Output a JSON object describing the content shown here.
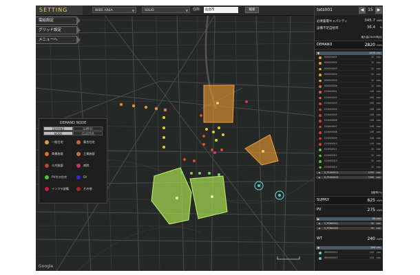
{
  "topbar": {
    "title": "SETTING",
    "area_select": "WIDE AREA",
    "mode_select": "SOLID",
    "location_label": "住所:",
    "location_value": "仙台市",
    "search_button": "検索"
  },
  "side_menu": [
    "需給設定",
    "グリッド設定",
    "メニューへ"
  ],
  "legend": {
    "title": "DEMAND NODE",
    "tabs_row1": [
      "DEMAND",
      "SUPPLY"
    ],
    "tabs_row2": [
      "NODE",
      "CLUSTER"
    ],
    "items": [
      {
        "label": "一般住宅",
        "color": "#e0a030"
      },
      {
        "label": "集合住宅",
        "color": "#d06040"
      },
      {
        "label": "商業施設",
        "color": "#e07030"
      },
      {
        "label": "工業施設",
        "color": "#c87050"
      },
      {
        "label": "公共施設",
        "color": "#c84040"
      },
      {
        "label": "病院",
        "color": "#c83070"
      },
      {
        "label": "PV付き住宅",
        "color": "#55c040"
      },
      {
        "label": "EV",
        "color": "#2a2ad0"
      },
      {
        "label": "インフラ設備",
        "color": "#c02040"
      },
      {
        "label": "その他",
        "color": "#b02020"
      }
    ]
  },
  "map": {
    "google_text": "Google",
    "node_colors": {
      "orange": "#e0913a",
      "yellow": "#e3d02c",
      "red": "#d0503a",
      "magenta": "#d03090",
      "green": "#7cd060",
      "cyan": "#60c8c8"
    },
    "polygon_colors": {
      "orange": "#e0922e",
      "green": "#a6e050"
    }
  },
  "panel": {
    "user": "tets001",
    "page": "15",
    "capacity_label": "必要蓄電キャパシティ",
    "capacity_value": "345.7",
    "capacity_unit": "kWh",
    "shortage_label": "設備不足自給率",
    "shortage_value": "36.4",
    "shortage_unit": "%",
    "max_demand_label": "最大量(08:00時点)",
    "demand": {
      "label": "DEMAND",
      "value": "2820",
      "unit": "kWh"
    },
    "demand_header": {
      "value": "1535",
      "unit": "kWh"
    },
    "demand_list": [
      {
        "name": "D00000001",
        "value": "12",
        "color": "#e0a030"
      },
      {
        "name": "D00000002",
        "value": "12",
        "color": "#e0a030"
      },
      {
        "name": "D00000003",
        "value": "12",
        "color": "#e0a030"
      },
      {
        "name": "D00000004",
        "value": "12",
        "color": "#e0a030"
      },
      {
        "name": "D00000005",
        "value": "12",
        "color": "#e0a030"
      },
      {
        "name": "D00000006",
        "value": "12",
        "color": "#d06040"
      },
      {
        "name": "D10000001",
        "value": "100",
        "color": "#d06040"
      },
      {
        "name": "D10000002",
        "value": "100",
        "color": "#d06040"
      },
      {
        "name": "D10000003",
        "value": "100",
        "color": "#c84040"
      },
      {
        "name": "D10000004",
        "value": "100",
        "color": "#c84040"
      },
      {
        "name": "D10000005",
        "value": "100",
        "color": "#c84040"
      },
      {
        "name": "D10000006",
        "value": "100",
        "color": "#c84040"
      },
      {
        "name": "D10000007",
        "value": "100",
        "color": "#c84040"
      },
      {
        "name": "D10000008",
        "value": "100",
        "color": "#c84040"
      },
      {
        "name": "D10000009",
        "value": "100",
        "color": "#c84040"
      },
      {
        "name": "D10000010",
        "value": "100",
        "color": "#c84040"
      },
      {
        "name": "D10000011",
        "value": "10",
        "color": "#55c040"
      },
      {
        "name": "D10000012",
        "value": "10",
        "color": "#55c040"
      },
      {
        "name": "D10000013",
        "value": "10",
        "color": "#55c040"
      },
      {
        "name": "D10000014",
        "value": "10",
        "color": "#55c040"
      }
    ],
    "demand_groups": [
      {
        "name": "D_PCA00001",
        "value": "1260"
      },
      {
        "name": "D_PCA00002",
        "value": "1260"
      }
    ],
    "supply_rate_label": "自給率(%)",
    "supply": {
      "label": "SUPPLY",
      "value": "625",
      "unit": "kWh"
    },
    "pv": {
      "label": "PV",
      "value": "275",
      "unit": "kWh"
    },
    "pv_header": {
      "value": "95",
      "unit": "kWh"
    },
    "pv_list": [
      {
        "name": "S_PCN00001",
        "value": "90"
      },
      {
        "name": "S_PCN00002",
        "value": "90"
      }
    ],
    "wt": {
      "label": "WT",
      "value": "240",
      "unit": "kWh"
    },
    "wt_header": {
      "value": "240",
      "unit": "kWh"
    },
    "wt_list": [
      {
        "name": "W00000001",
        "value": "120",
        "color": "#60c8c8"
      },
      {
        "name": "W00000002",
        "value": "120",
        "color": "#60c8c8"
      }
    ],
    "list_unit": "kWh"
  }
}
